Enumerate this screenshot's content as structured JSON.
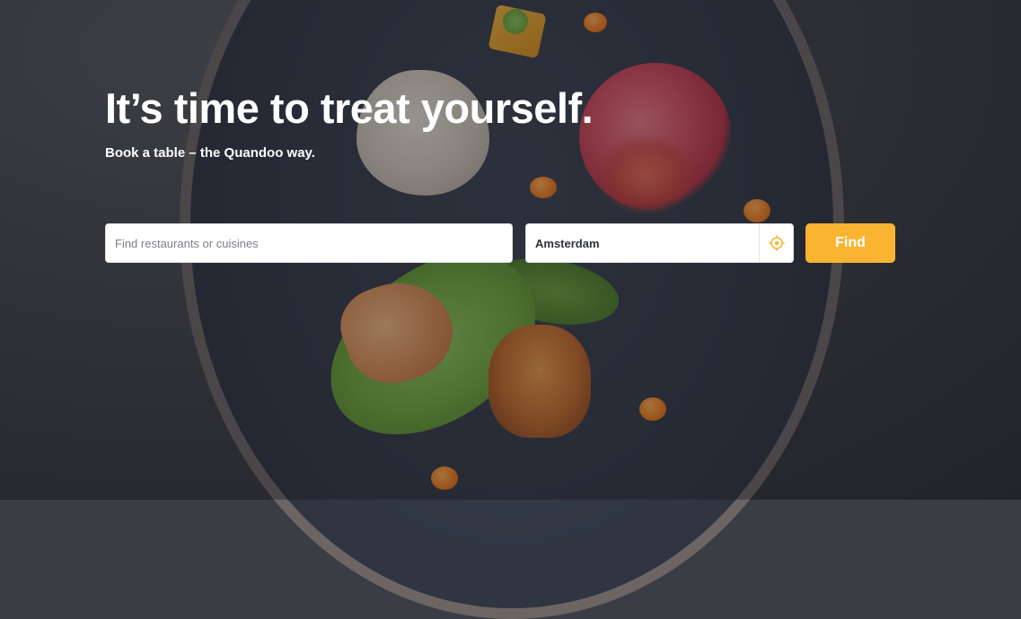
{
  "hero": {
    "headline": "It’s time to treat yourself.",
    "subheadline": "Book a table – the Quandoo way."
  },
  "search": {
    "query_placeholder": "Find restaurants or cuisines",
    "query_value": "",
    "location_value": "Amsterdam",
    "locate_icon": "crosshair-location-icon",
    "find_label": "Find"
  },
  "colors": {
    "accent": "#fbb332",
    "text_on_hero": "#ffffff",
    "location_text": "#2f3237",
    "placeholder": "#7c7f85"
  }
}
